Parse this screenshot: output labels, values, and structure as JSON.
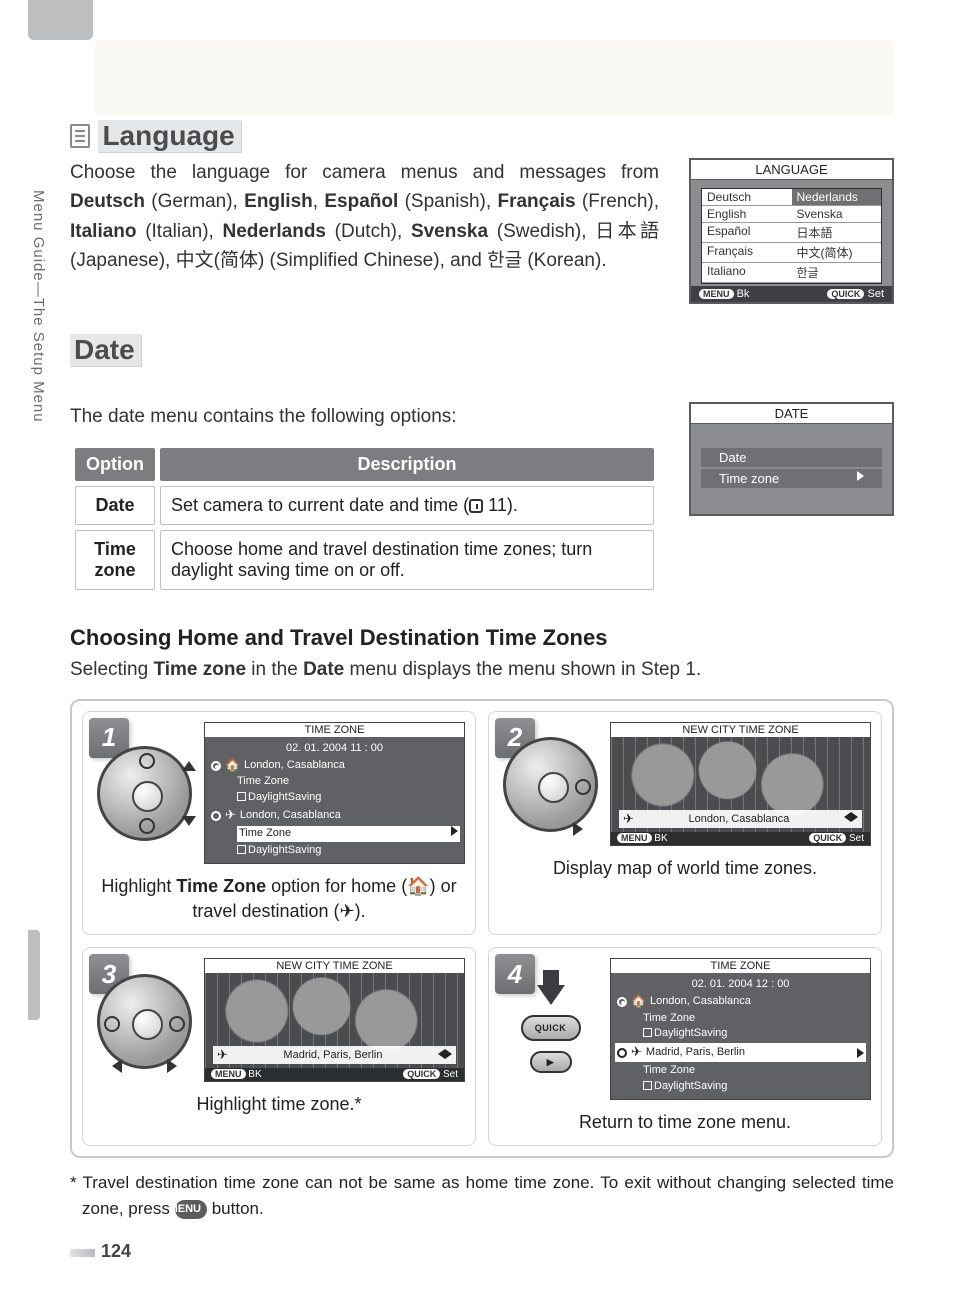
{
  "side_label": "Menu Guide—The Setup Menu",
  "page_number": "124",
  "language": {
    "heading": "Language",
    "intro_prefix": "Choose the language for camera menus and messages from ",
    "l_deutsch": "Deutsch",
    "p_deutsch": " (German), ",
    "l_english": "English",
    "p_english": ", ",
    "l_espanol": "Español",
    "p_espanol": " (Spanish), ",
    "l_francais": "Français",
    "p_francais": " (French), ",
    "l_italiano": "Italiano",
    "p_italiano": " (Italian), ",
    "l_nederlands": "Nederlands",
    "p_nederlands": " (Dutch), ",
    "l_svenska": "Svenska",
    "p_svenska": " (Swedish), ",
    "l_japanese": "日本語",
    "p_japanese": " (Japanese), ",
    "l_chinese": "中文(简体)",
    "p_chinese": " (Simplified Chinese), and ",
    "l_korean": "한글",
    "p_korean": " (Korean).",
    "lcd_title": "LANGUAGE",
    "lcd_items": {
      "deutsch": "Deutsch",
      "nederlands": "Nederlands",
      "english": "English",
      "svenska": "Svenska",
      "espanol": "Español",
      "japanese": "日本語",
      "francais": "Français",
      "chinese": "中文(简体)",
      "italiano": "Italiano",
      "korean": "한글"
    },
    "lcd_foot_bk_pill": "MENU",
    "lcd_foot_bk": "Bk",
    "lcd_foot_set_pill": "QUICK",
    "lcd_foot_set": "Set"
  },
  "date": {
    "heading": "Date",
    "intro": "The date menu contains the following options:",
    "th_option": "Option",
    "th_desc": "Description",
    "row1_opt": "Date",
    "row1_desc_pre": "Set camera to current date and time (",
    "row1_desc_post": " 11).",
    "row2_opt": "Time zone",
    "row2_desc": "Choose home and travel destination time zones; turn daylight saving time on or off.",
    "lcd_title": "DATE",
    "lcd_item1": "Date",
    "lcd_item2": "Time zone"
  },
  "tz": {
    "heading": "Choosing Home and Travel Destination Time Zones",
    "intro_pre": "Selecting ",
    "intro_b1": "Time zone",
    "intro_mid": " in the ",
    "intro_b2": "Date",
    "intro_post": " menu displays the menu shown in Step 1."
  },
  "steps": {
    "s1": {
      "num": "1",
      "lcd_title": "TIME ZONE",
      "datetime": "02. 01. 2004  11 : 00",
      "home_city": "London, Casablanca",
      "tz_label": "Time Zone",
      "ds_label": "DaylightSaving",
      "travel_city": "London, Casablanca",
      "caption_pre": "Highlight ",
      "caption_b": "Time Zone",
      "caption_post": " option for home (🏠) or travel destination (✈)."
    },
    "s2": {
      "num": "2",
      "lcd_title": "NEW CITY TIME ZONE",
      "city": "London, Casablanca",
      "foot_bk": "BK",
      "foot_set": "Set",
      "caption": "Display map of world time zones."
    },
    "s3": {
      "num": "3",
      "lcd_title": "NEW CITY TIME ZONE",
      "city": "Madrid, Paris, Berlin",
      "foot_bk": "BK",
      "foot_set": "Set",
      "caption": "Highlight time zone.*"
    },
    "s4": {
      "num": "4",
      "quick_label": "QUICK",
      "play_label": "▶",
      "lcd_title": "TIME ZONE",
      "datetime": "02. 01. 2004  12 : 00",
      "home_city": "London, Casablanca",
      "tz_label": "Time Zone",
      "ds_label": "DaylightSaving",
      "travel_city": "Madrid, Paris, Berlin",
      "caption": "Return to time zone menu."
    }
  },
  "footnote": {
    "pre": "* Travel destination time zone can not be same as home time zone.  To exit without changing selected time zone, press ",
    "btn": "MENU",
    "post": " button."
  }
}
